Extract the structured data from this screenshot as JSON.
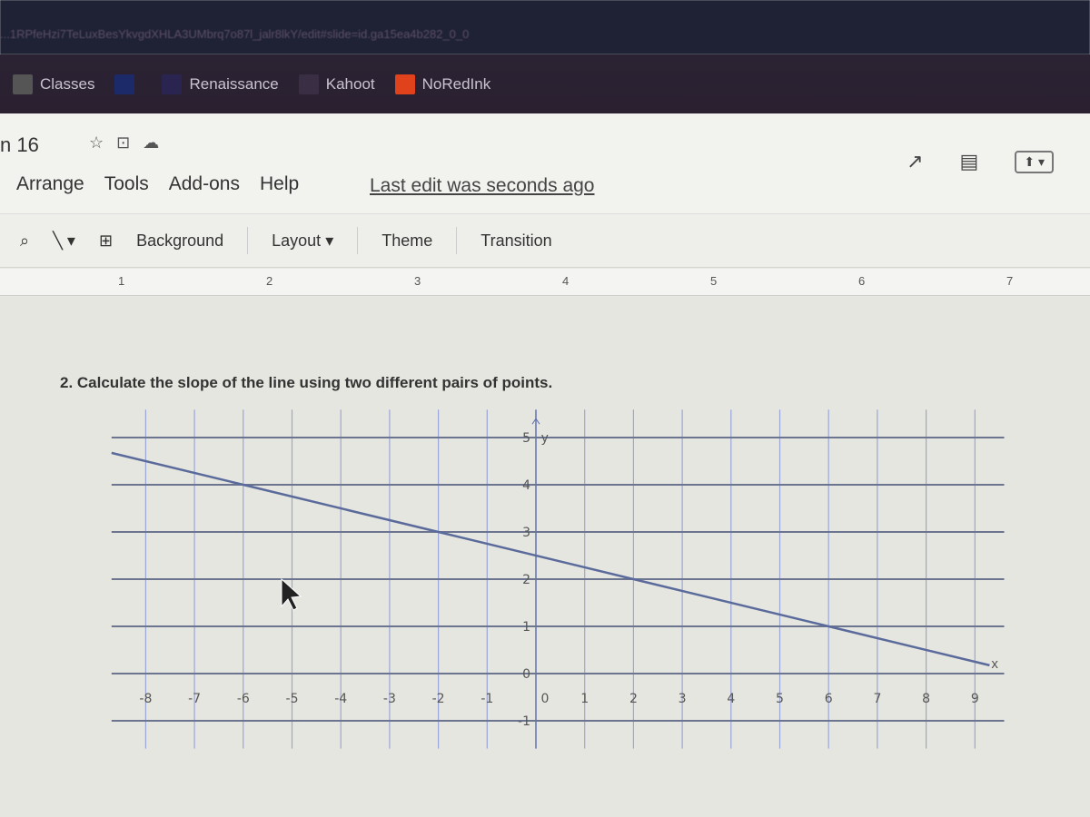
{
  "browser": {
    "url_text": "...1RPfeHzi7TeLuxBesYkvgdXHLA3UMbrq7o87l_jalr8lkY/edit#slide=id.ga15ea4b282_0_0",
    "bookmarks": [
      {
        "label": "Classes",
        "icon": "folder-icon",
        "color": "#555555"
      },
      {
        "label": "",
        "icon": "hac-icon",
        "color": "#1c2a6a"
      },
      {
        "label": "Renaissance",
        "icon": "renaissance-icon",
        "color": "#2a2550"
      },
      {
        "label": "Kahoot",
        "icon": "kahoot-icon",
        "color": "#3a2e44"
      },
      {
        "label": "NoRedInk",
        "icon": "noredink-icon",
        "color": "#e0421b"
      }
    ]
  },
  "app": {
    "title": "n 16",
    "menu": [
      "Arrange",
      "Tools",
      "Add-ons",
      "Help"
    ],
    "last_edit": "Last edit was seconds ago"
  },
  "toolbar": {
    "items": [
      "Background",
      "Layout",
      "Theme",
      "Transition"
    ]
  },
  "ruler": [
    "1",
    "2",
    "3",
    "4",
    "5",
    "6",
    "7"
  ],
  "slide": {
    "question": "2.  Calculate the slope of the line using two different pairs of points."
  },
  "chart_data": {
    "type": "line",
    "xlabel": "x",
    "ylabel": "y",
    "x_ticks": [
      "-8",
      "-7",
      "-6",
      "-5",
      "-4",
      "-3",
      "-2",
      "-1",
      "0",
      "1",
      "2",
      "3",
      "4",
      "5",
      "6",
      "7",
      "8",
      "9"
    ],
    "y_ticks": [
      "5",
      "4",
      "3",
      "2",
      "1",
      "0",
      "-1"
    ],
    "xlim": [
      -8.7,
      9.6
    ],
    "ylim": [
      -1.3,
      5.4
    ],
    "grid": true,
    "series": [
      {
        "points": [
          [
            -8.7,
            4.675
          ],
          [
            -6,
            4
          ],
          [
            -2,
            3
          ],
          [
            2,
            2
          ],
          [
            6,
            1
          ],
          [
            9.3,
            0.175
          ]
        ],
        "color": "#5a6a9a"
      }
    ]
  }
}
